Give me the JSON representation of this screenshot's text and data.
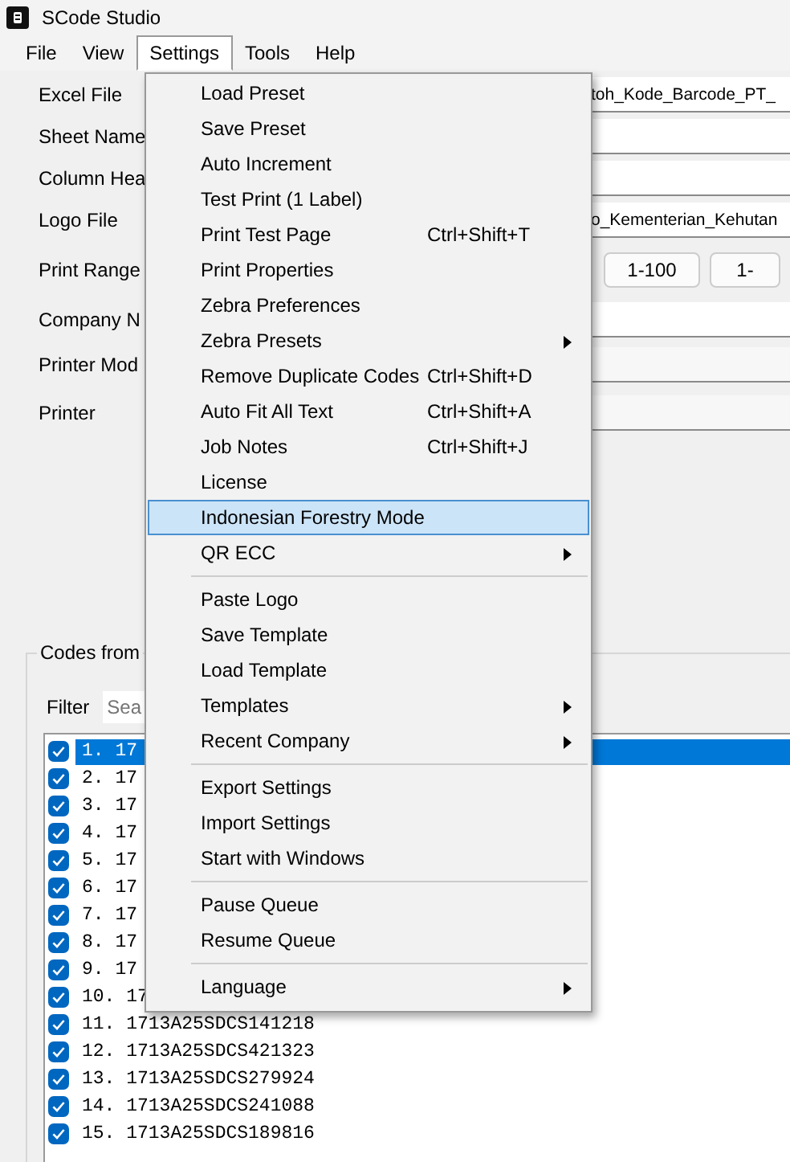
{
  "window": {
    "title": "SCode Studio"
  },
  "menubar": [
    {
      "label": "File",
      "selected": false
    },
    {
      "label": "View",
      "selected": false
    },
    {
      "label": "Settings",
      "selected": true
    },
    {
      "label": "Tools",
      "selected": false
    },
    {
      "label": "Help",
      "selected": false
    }
  ],
  "form": [
    {
      "label": "Excel File",
      "kind": "field",
      "value": "toh_Kode_Barcode_PT_"
    },
    {
      "label": "Sheet Name",
      "kind": "field"
    },
    {
      "label": "Column Hea",
      "kind": "field"
    },
    {
      "label": "Logo File",
      "kind": "field",
      "value": "o_Kementerian_Kehutan"
    },
    {
      "label": "Print Range",
      "kind": "buttons",
      "buttons": [
        "1-100",
        "1-"
      ]
    },
    {
      "label": "Company N",
      "kind": "field"
    },
    {
      "label": "Printer Mod",
      "kind": "combo"
    },
    {
      "label": "Printer",
      "kind": "combo"
    }
  ],
  "codes": {
    "group_title": "Codes from",
    "filter_label": "Filter",
    "filter_placeholder": "Sea",
    "items": [
      {
        "text": "1. 17",
        "checked": true,
        "selected": true
      },
      {
        "text": "2. 17",
        "checked": true,
        "selected": false
      },
      {
        "text": "3. 17",
        "checked": true,
        "selected": false
      },
      {
        "text": "4. 17",
        "checked": true,
        "selected": false
      },
      {
        "text": "5. 17",
        "checked": true,
        "selected": false
      },
      {
        "text": "6. 17",
        "checked": true,
        "selected": false
      },
      {
        "text": "7. 17",
        "checked": true,
        "selected": false
      },
      {
        "text": "8. 17",
        "checked": true,
        "selected": false
      },
      {
        "text": "9. 17",
        "checked": true,
        "selected": false
      },
      {
        "text": "10. 17",
        "checked": true,
        "selected": false
      },
      {
        "text": "11. 1713A25SDCS141218",
        "checked": true,
        "selected": false
      },
      {
        "text": "12. 1713A25SDCS421323",
        "checked": true,
        "selected": false
      },
      {
        "text": "13. 1713A25SDCS279924",
        "checked": true,
        "selected": false
      },
      {
        "text": "14. 1713A25SDCS241088",
        "checked": true,
        "selected": false
      },
      {
        "text": "15. 1713A25SDCS189816",
        "checked": true,
        "selected": false
      }
    ]
  },
  "menu": [
    {
      "kind": "item",
      "label": "Load Preset",
      "submenu": false,
      "selected": false
    },
    {
      "kind": "item",
      "label": "Save Preset",
      "submenu": false,
      "selected": false
    },
    {
      "kind": "item",
      "label": "Auto Increment",
      "submenu": false,
      "selected": false
    },
    {
      "kind": "item",
      "label": "Test Print (1 Label)",
      "submenu": false,
      "selected": false
    },
    {
      "kind": "item",
      "label": "Print Test Page",
      "shortcut": "Ctrl+Shift+T",
      "submenu": false,
      "selected": false
    },
    {
      "kind": "item",
      "label": "Print Properties",
      "submenu": false,
      "selected": false
    },
    {
      "kind": "item",
      "label": "Zebra Preferences",
      "submenu": false,
      "selected": false
    },
    {
      "kind": "item",
      "label": "Zebra Presets",
      "submenu": true,
      "selected": false
    },
    {
      "kind": "item",
      "label": "Remove Duplicate Codes",
      "shortcut": "Ctrl+Shift+D",
      "submenu": false,
      "selected": false
    },
    {
      "kind": "item",
      "label": "Auto Fit All Text",
      "shortcut": "Ctrl+Shift+A",
      "submenu": false,
      "selected": false
    },
    {
      "kind": "item",
      "label": "Job Notes",
      "shortcut": "Ctrl+Shift+J",
      "submenu": false,
      "selected": false
    },
    {
      "kind": "item",
      "label": "License",
      "submenu": false,
      "selected": false
    },
    {
      "kind": "item",
      "label": "Indonesian Forestry Mode",
      "submenu": false,
      "selected": true
    },
    {
      "kind": "item",
      "label": "QR ECC",
      "submenu": true,
      "selected": false
    },
    {
      "kind": "separator"
    },
    {
      "kind": "item",
      "label": "Paste Logo",
      "submenu": false,
      "selected": false
    },
    {
      "kind": "item",
      "label": "Save Template",
      "submenu": false,
      "selected": false
    },
    {
      "kind": "item",
      "label": "Load Template",
      "submenu": false,
      "selected": false
    },
    {
      "kind": "item",
      "label": "Templates",
      "submenu": true,
      "selected": false
    },
    {
      "kind": "item",
      "label": "Recent Company",
      "submenu": true,
      "selected": false
    },
    {
      "kind": "separator"
    },
    {
      "kind": "item",
      "label": "Export Settings",
      "submenu": false,
      "selected": false
    },
    {
      "kind": "item",
      "label": "Import Settings",
      "submenu": false,
      "selected": false
    },
    {
      "kind": "item",
      "label": "Start with Windows",
      "submenu": false,
      "selected": false
    },
    {
      "kind": "separator"
    },
    {
      "kind": "item",
      "label": "Pause Queue",
      "submenu": false,
      "selected": false
    },
    {
      "kind": "item",
      "label": "Resume Queue",
      "submenu": false,
      "selected": false
    },
    {
      "kind": "separator"
    },
    {
      "kind": "item",
      "label": "Language",
      "submenu": true,
      "selected": false
    }
  ]
}
